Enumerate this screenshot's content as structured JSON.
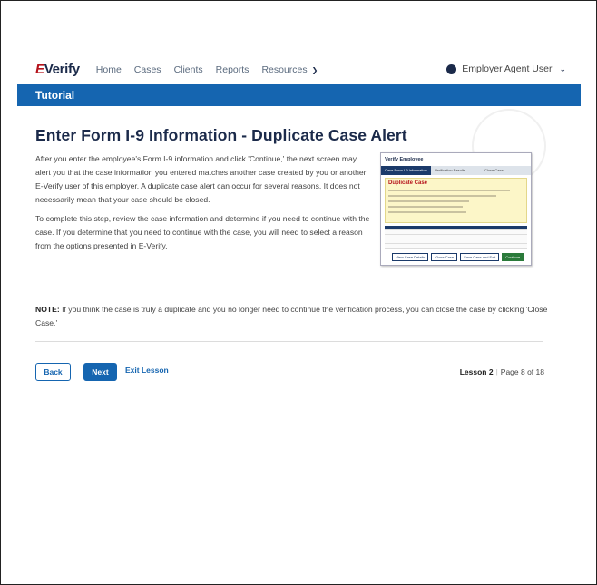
{
  "brand": {
    "logo_e": "E",
    "logo_rest": "Verify"
  },
  "nav": {
    "home": "Home",
    "cases": "Cases",
    "clients": "Clients",
    "reports": "Reports",
    "resources": "Resources",
    "user": "Employer Agent User"
  },
  "banner": {
    "title": "Tutorial"
  },
  "page": {
    "title": "Enter Form I-9 Information - Duplicate Case Alert",
    "paragraph1": "After you enter the employee's Form I-9 information and click 'Continue,' the next screen may alert you that the case information you entered matches another case created by you or another E-Verify user of this employer. A duplicate case alert can occur for several reasons. It does not necessarily mean that your case should be closed.",
    "paragraph2": "To complete this step, review the case information and determine if you need to continue with the case. If you determine that you need to continue with the case, you will need to select a reason from the options presented in E-Verify.",
    "note_label": "NOTE:",
    "note_text": " If you think the case is truly a duplicate and you no longer need to continue the verification process, you can close the case by clicking 'Close Case.'"
  },
  "screenshot_thumb": {
    "header": "Verify Employee",
    "steps": [
      "Case Form I-9 Information",
      "Verification Results",
      "Close Case"
    ],
    "alert_title": "Duplicate Case",
    "buttons": [
      "View Case Details",
      "Close Case",
      "Save Case and Exit",
      "Continue"
    ]
  },
  "footer": {
    "back": "Back",
    "next": "Next",
    "exit": "Exit Lesson",
    "lesson_label": "Lesson 2",
    "page_indicator": "Page 8 of 18"
  },
  "colors": {
    "primary": "#1565b0",
    "brand_red": "#b5121b",
    "navy": "#1b2a4a"
  }
}
